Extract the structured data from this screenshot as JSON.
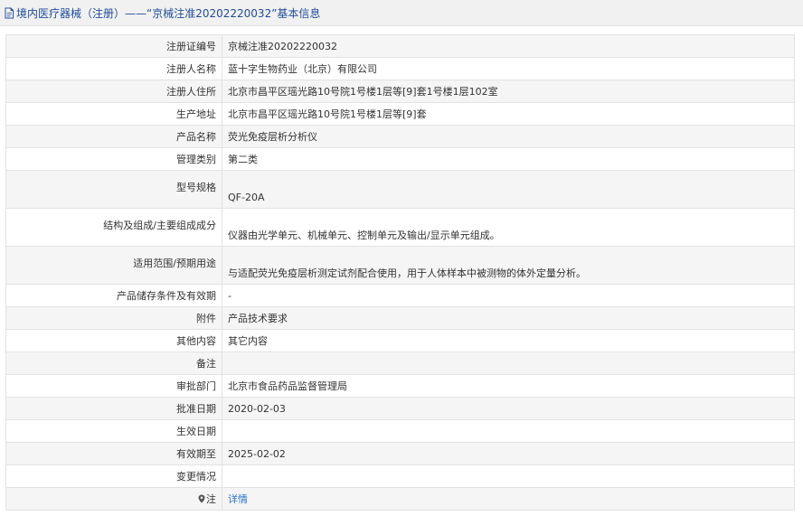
{
  "header": {
    "title": "境内医疗器械（注册）——“京械注准20202220032”基本信息"
  },
  "rows": [
    {
      "label": "注册证编号",
      "value": "京械注准20202220032"
    },
    {
      "label": "注册人名称",
      "value": "蓝十字生物药业（北京）有限公司"
    },
    {
      "label": "注册人住所",
      "value": "北京市昌平区瑶光路10号院1号楼1层等[9]套1号楼1层102室"
    },
    {
      "label": "生产地址",
      "value": "北京市昌平区瑶光路10号院1号楼1层等[9]套"
    },
    {
      "label": "产品名称",
      "value": "荧光免疫层析分析仪"
    },
    {
      "label": "管理类别",
      "value": "第二类"
    },
    {
      "label": "型号规格",
      "value": "QF-20A"
    },
    {
      "label": "结构及组成/主要组成成分",
      "value": "仪器由光学单元、机械单元、控制单元及输出/显示单元组成。"
    },
    {
      "label": "适用范围/预期用途",
      "value": "与适配荧光免疫层析测定试剂配合使用，用于人体样本中被测物的体外定量分析。"
    },
    {
      "label": "产品储存条件及有效期",
      "value": "-"
    },
    {
      "label": "附件",
      "value": "产品技术要求"
    },
    {
      "label": "其他内容",
      "value": "其它内容"
    },
    {
      "label": "备注",
      "value": ""
    },
    {
      "label": "审批部门",
      "value": "北京市食品药品监督管理局"
    },
    {
      "label": "批准日期",
      "value": "2020-02-03"
    },
    {
      "label": "生效日期",
      "value": ""
    },
    {
      "label": "有效期至",
      "value": "2025-02-02"
    },
    {
      "label": "变更情况",
      "value": ""
    },
    {
      "label": "注",
      "value": "详情"
    }
  ],
  "colors": {
    "title_text": "#1f4b9a",
    "link": "#2a74c9",
    "shaded_row": "#f5f5f5",
    "border": "#e2e2e2"
  },
  "icons": {
    "header_icon": "document-icon",
    "note_icon": "map-pin-icon"
  }
}
